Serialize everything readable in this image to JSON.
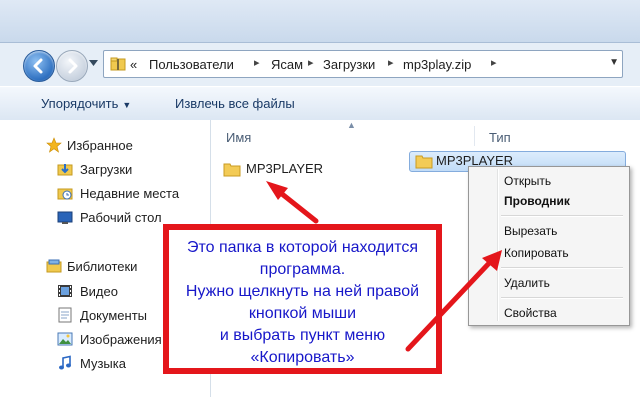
{
  "address": {
    "overflow": "«",
    "crumbs": [
      "Пользователи",
      "Ясам",
      "Загрузки",
      "mp3play.zip"
    ]
  },
  "toolbar": {
    "organize_label": "Упорядочить",
    "extract_label": "Извлечь все файлы"
  },
  "nav": {
    "favorites_header": "Избранное",
    "favorites": [
      "Загрузки",
      "Недавние места",
      "Рабочий стол"
    ],
    "libraries_header": "Библиотеки",
    "libraries": [
      "Видео",
      "Документы",
      "Изображения",
      "Музыка"
    ]
  },
  "columns": {
    "name": "Имя",
    "type": "Тип"
  },
  "files": [
    {
      "name": "MP3PLAYER"
    },
    {
      "name": "MP3PLAYER"
    }
  ],
  "context_menu": {
    "items": [
      "Открыть",
      "Проводник",
      "Вырезать",
      "Копировать",
      "Удалить",
      "Свойства"
    ]
  },
  "annotation": {
    "lines": [
      "Это папка в которой находится",
      "программа.",
      "Нужно щелкнуть на ней правой",
      "кнопкой мыши",
      "и выбрать пункт меню",
      "«Копировать»"
    ]
  },
  "colors": {
    "annotation_border": "#e4161b",
    "annotation_text": "#1717c9",
    "arrow": "#e4161b"
  }
}
